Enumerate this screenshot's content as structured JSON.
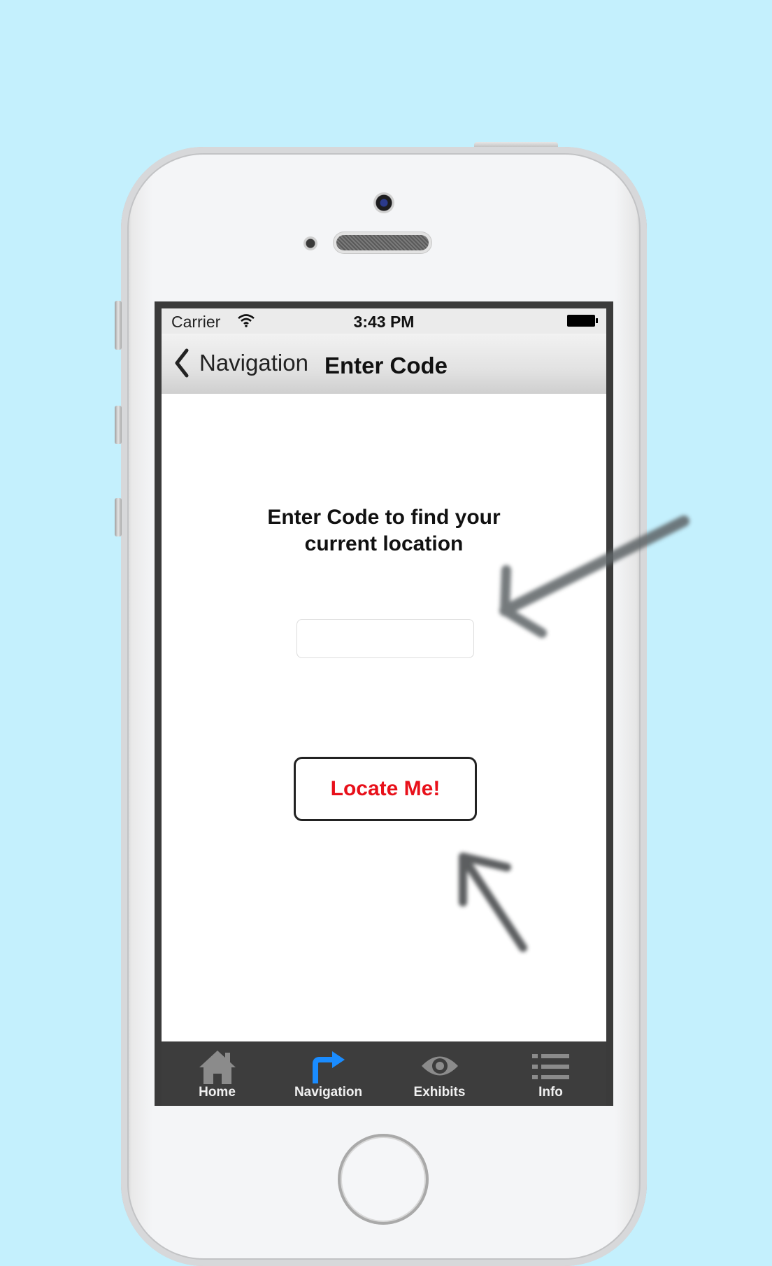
{
  "status_bar": {
    "carrier": "Carrier",
    "time": "3:43 PM"
  },
  "nav_bar": {
    "back_label": "Navigation",
    "title": "Enter Code"
  },
  "main": {
    "prompt_line1": "Enter Code to find your",
    "prompt_line2": "current location",
    "code_input": {
      "value": "",
      "placeholder": ""
    },
    "locate_button": "Locate Me!"
  },
  "tab_bar": {
    "tabs": [
      {
        "label": "Home",
        "icon": "home-icon",
        "active": false
      },
      {
        "label": "Navigation",
        "icon": "turn-right-arrow-icon",
        "active": true
      },
      {
        "label": "Exhibits",
        "icon": "eye-icon",
        "active": false
      },
      {
        "label": "Info",
        "icon": "list-icon",
        "active": false
      }
    ]
  },
  "colors": {
    "background": "#c4f0fd",
    "button_text": "#e8101a",
    "tab_bar": "#3d3d3d",
    "active_tab_icon": "#1a8cff"
  }
}
